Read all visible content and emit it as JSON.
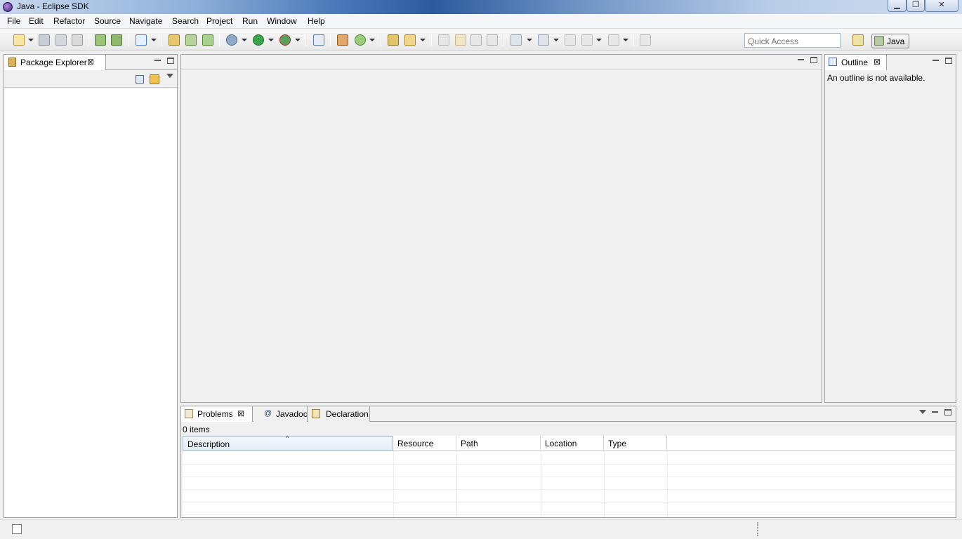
{
  "window": {
    "title": "Java - Eclipse SDK",
    "controls": {
      "minimize": "▁",
      "maximize": "❐",
      "close": "✕"
    }
  },
  "menu": {
    "items": [
      "File",
      "Edit",
      "Refactor",
      "Source",
      "Navigate",
      "Search",
      "Project",
      "Run",
      "Window",
      "Help"
    ]
  },
  "toolbar": {
    "quick_access_placeholder": "Quick Access",
    "perspective_label": "Java",
    "icons": [
      "new-icon",
      "save-icon",
      "save-all-icon",
      "print-icon",
      "import-icon",
      "export-icon",
      "task-icon",
      "new-java-project-icon",
      "new-java-package-icon",
      "new-java-class-icon",
      "debug-icon",
      "run-icon",
      "coverage-icon",
      "skip-breakpoints-icon",
      "open-type-icon",
      "new-enum-icon",
      "open-task-icon",
      "search-icon",
      "toggle-mark-occurrences-icon",
      "toggle-highlight-icon",
      "toggle-block-icon",
      "show-whitespace-icon",
      "next-annotation-icon",
      "previous-annotation-icon",
      "last-edit-icon",
      "back-icon",
      "forward-icon",
      "pin-icon"
    ]
  },
  "package_explorer": {
    "tab_label": "Package Explorer",
    "close_glyph": "⊠"
  },
  "outline": {
    "tab_label": "Outline",
    "close_glyph": "⊠",
    "message": "An outline is not available."
  },
  "problems": {
    "tabs": [
      {
        "label": "Problems",
        "icon": "problems-icon",
        "active": true
      },
      {
        "label": "Javadoc",
        "icon": "javadoc-icon",
        "active": false
      },
      {
        "label": "Declaration",
        "icon": "declaration-icon",
        "active": false
      }
    ],
    "close_glyph": "⊠",
    "items_count": "0 items",
    "columns": [
      "Description",
      "Resource",
      "Path",
      "Location",
      "Type"
    ],
    "sort_glyph": "^",
    "rows": []
  },
  "colors": {
    "accent": "#4a78b8",
    "tab_border": "#a0a0a0"
  }
}
